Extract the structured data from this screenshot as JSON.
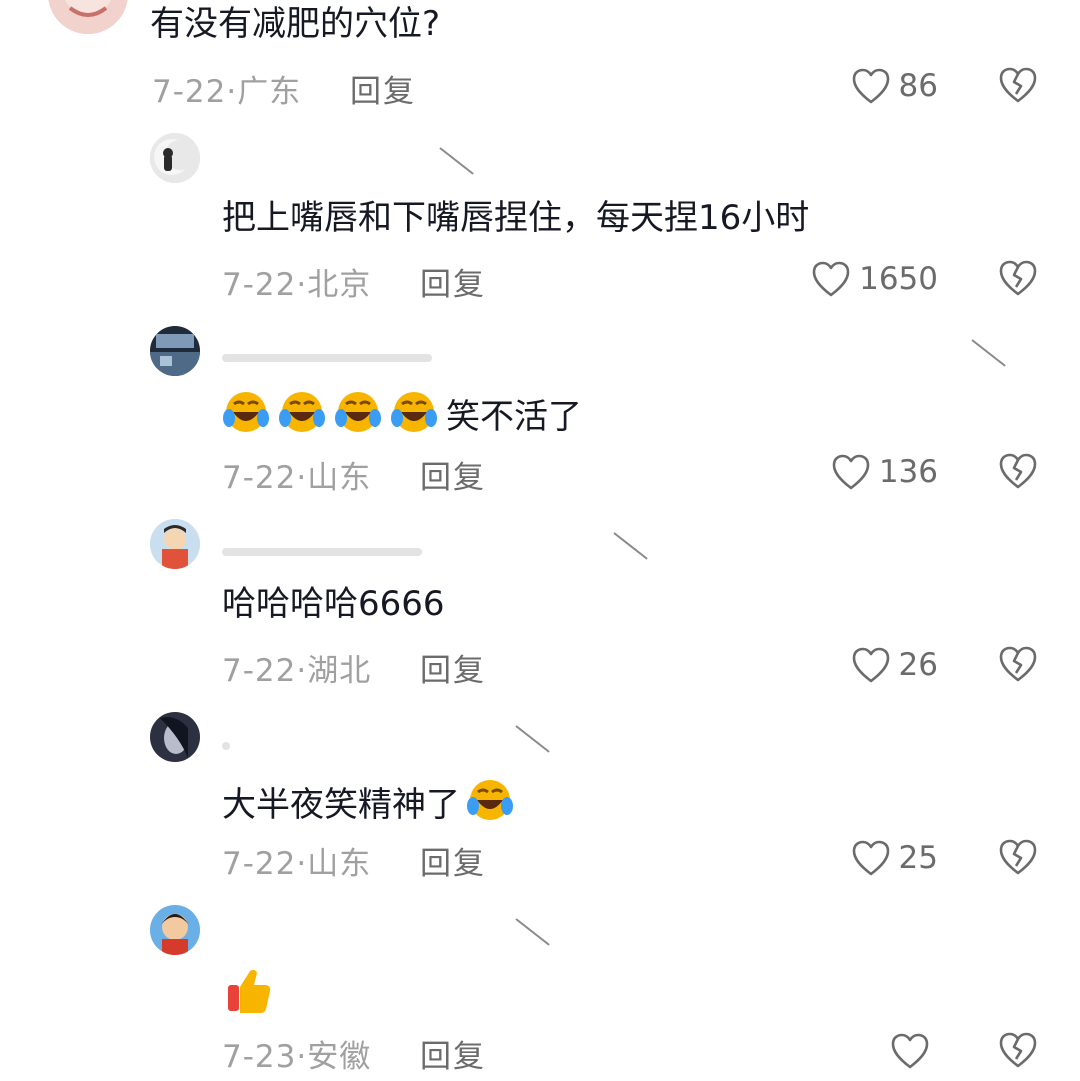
{
  "top_comment": {
    "text": "有没有减肥的穴位?",
    "date": "7-22·",
    "location": "广东",
    "reply_label": "回复",
    "likes": "86"
  },
  "replies": [
    {
      "text": "把上嘴唇和下嘴唇捏住，每天捏16小时",
      "date": "7-22·",
      "location": "北京",
      "reply_label": "回复",
      "likes": "1650"
    },
    {
      "text": "笑不活了",
      "date": "7-22·",
      "location": "山东",
      "reply_label": "回复",
      "likes": "136"
    },
    {
      "text": "哈哈哈哈6666",
      "date": "7-22·",
      "location": "湖北",
      "reply_label": "回复",
      "likes": "26"
    },
    {
      "text": "大半夜笑精神了",
      "date": "7-22·",
      "location": "山东",
      "reply_label": "回复",
      "likes": "25"
    },
    {
      "text": "",
      "date": "7-23·",
      "location": "安徽",
      "reply_label": "回复",
      "likes": ""
    }
  ],
  "icons": {
    "like": "heart-outline-icon",
    "dislike": "broken-heart-icon",
    "laugh_emoji": "laughing-tears-emoji",
    "thumb_emoji": "thumbs-up-emoji"
  },
  "colors": {
    "text_primary": "#161823",
    "meta_gray": "#a0a0a0",
    "reply_gray": "#6b6b6b",
    "background": "#ffffff"
  }
}
